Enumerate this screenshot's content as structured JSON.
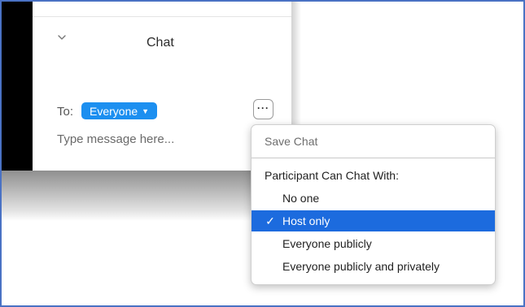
{
  "chat": {
    "title": "Chat",
    "to_label": "To:",
    "recipient": "Everyone",
    "message_placeholder": "Type message here...",
    "more_button_label": "···"
  },
  "menu": {
    "save_chat": "Save Chat",
    "participant_header": "Participant Can Chat With:",
    "options": [
      {
        "label": "No one",
        "checked": false
      },
      {
        "label": "Host only",
        "checked": true
      },
      {
        "label": "Everyone publicly",
        "checked": false
      },
      {
        "label": "Everyone publicly and privately",
        "checked": false
      }
    ],
    "checkmark": "✓"
  },
  "colors": {
    "accent": "#1c8ff0",
    "selection": "#1c6bde",
    "frame_border": "#4a72c4"
  }
}
